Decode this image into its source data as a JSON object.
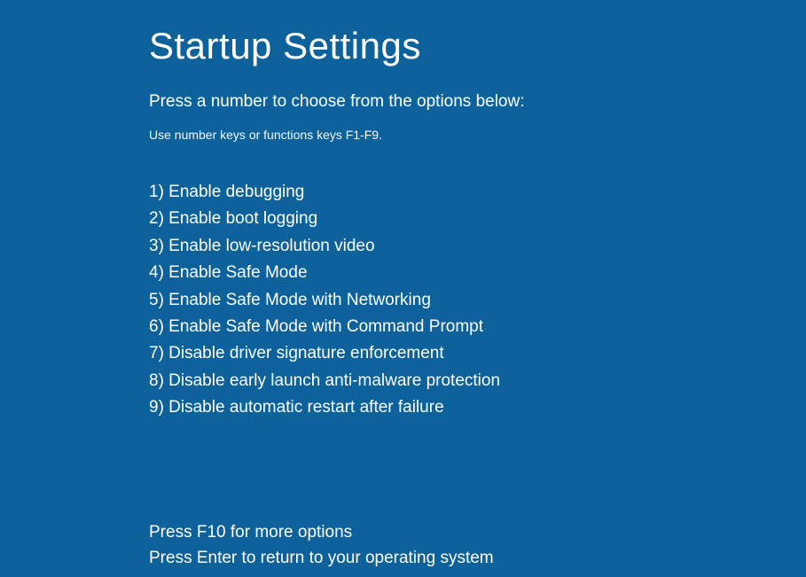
{
  "title": "Startup Settings",
  "subtitle": "Press a number to choose from the options below:",
  "hint": "Use number keys or functions keys F1-F9.",
  "options": [
    "1) Enable debugging",
    "2) Enable boot logging",
    "3) Enable low-resolution video",
    "4) Enable Safe Mode",
    "5) Enable Safe Mode with Networking",
    "6) Enable Safe Mode with Command Prompt",
    "7) Disable driver signature enforcement",
    "8) Disable early launch anti-malware protection",
    "9) Disable automatic restart after failure"
  ],
  "footer": {
    "more_options": "Press F10 for more options",
    "return_line": "Press Enter to return to your operating system"
  }
}
